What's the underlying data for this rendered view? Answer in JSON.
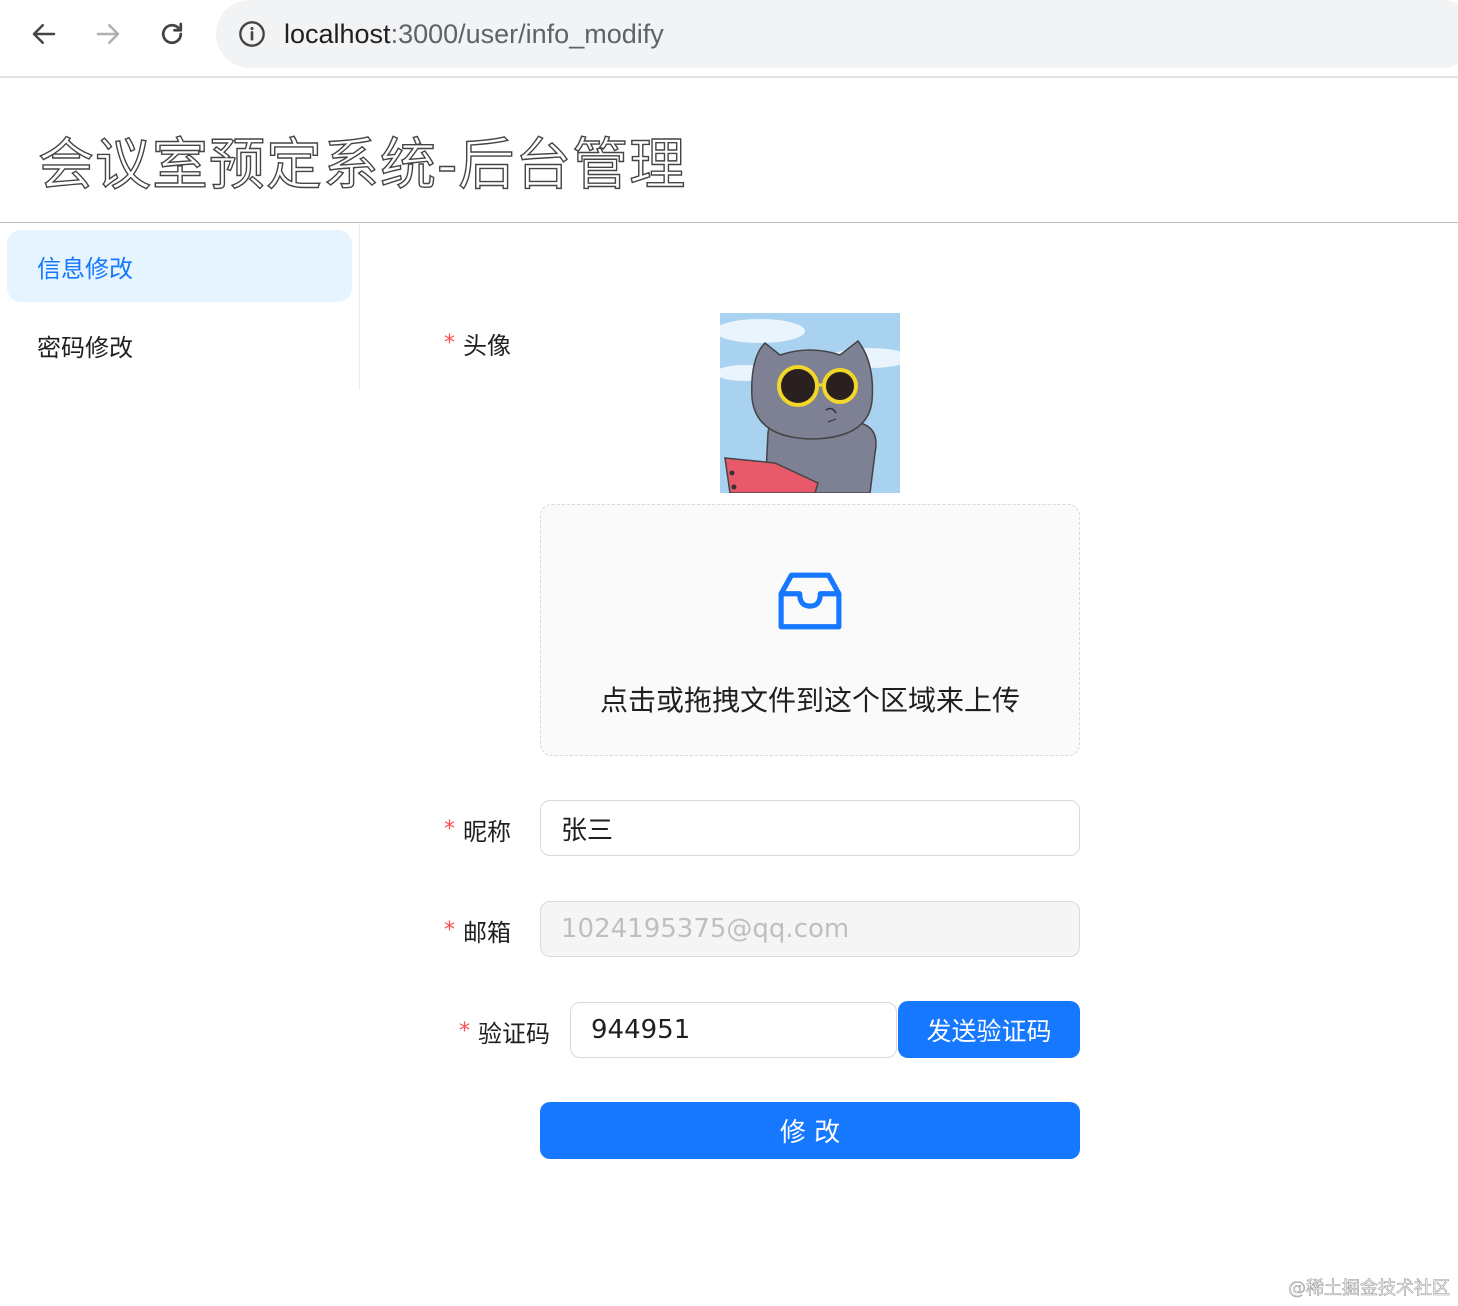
{
  "browser": {
    "url_host": "localhost",
    "url_path": ":3000/user/info_modify"
  },
  "app": {
    "title": "会议室预定系统-后台管理"
  },
  "sidebar": {
    "items": [
      {
        "label": "信息修改",
        "active": true
      },
      {
        "label": "密码修改",
        "active": false
      }
    ]
  },
  "form": {
    "avatar": {
      "label": "头像",
      "required_mark": "*"
    },
    "upload": {
      "hint": "点击或拖拽文件到这个区域来上传"
    },
    "nickname": {
      "label": "昵称",
      "required_mark": "*",
      "value": "张三"
    },
    "email": {
      "label": "邮箱",
      "required_mark": "*",
      "value": "1024195375@qq.com"
    },
    "captcha": {
      "label": "验证码",
      "required_mark": "*",
      "value": "944951",
      "send_button": "发送验证码"
    },
    "submit_button": "修 改"
  },
  "watermark": "@稀土掘金技术社区",
  "colors": {
    "primary": "#1677ff",
    "menu_active_bg": "#e6f4ff",
    "required": "#ff4d4f"
  }
}
